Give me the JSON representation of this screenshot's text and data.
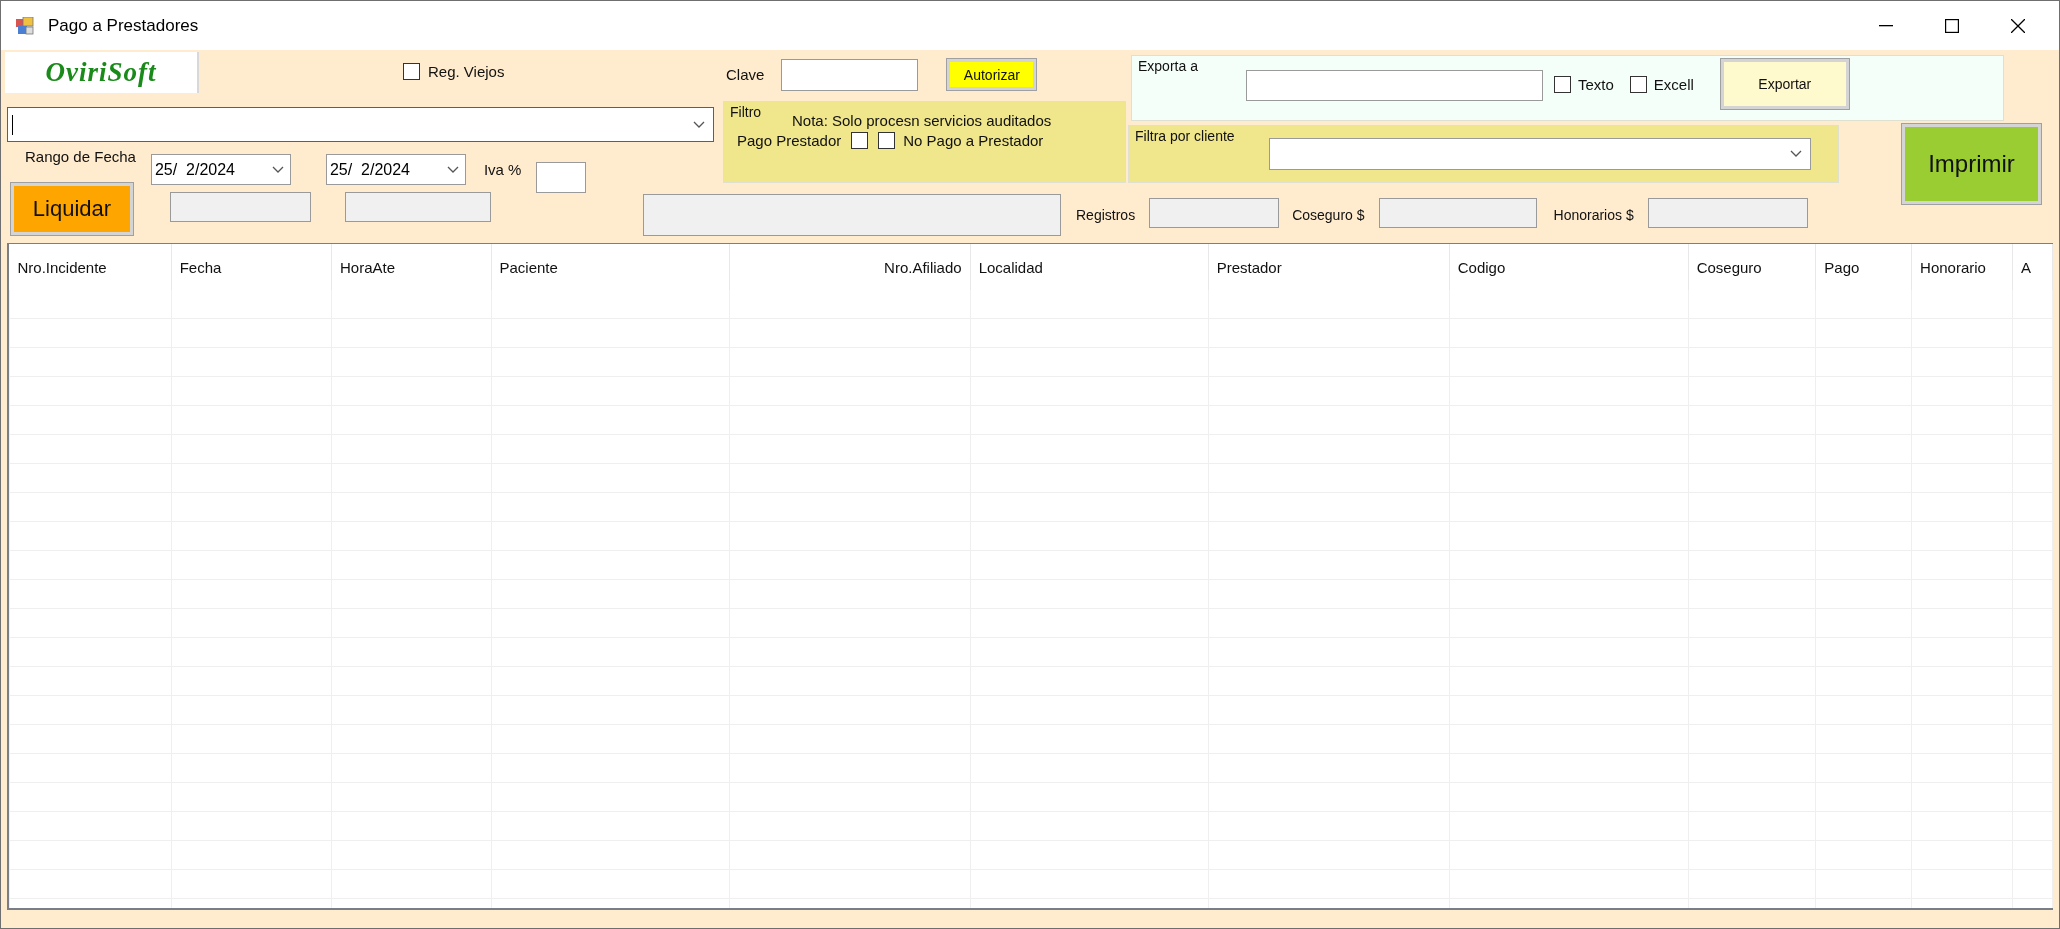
{
  "window": {
    "title": "Pago a Prestadores"
  },
  "logo": {
    "text": "OviriSoft"
  },
  "reg_viejos": {
    "label": "Reg. Viejos",
    "checked": false
  },
  "date_range": {
    "label": "Rango de Fecha",
    "from": "25/  2/2024",
    "to": "25/  2/2024"
  },
  "iva": {
    "label": "Iva %"
  },
  "liquidar_button": "Liquidar",
  "clave": {
    "label": "Clave"
  },
  "autorizar_button": "Autorizar",
  "filtro": {
    "title": "Filtro",
    "note": "Nota: Solo procesn servicios auditados",
    "options": [
      {
        "label": "Pago Prestador",
        "checked": false,
        "kind": "leading"
      },
      {
        "label": "No Pago a Prestador",
        "checked": false,
        "kind": "trailing"
      }
    ]
  },
  "export": {
    "title": "Exporta a",
    "options": [
      {
        "label": "Texto",
        "checked": false
      },
      {
        "label": "Excell",
        "checked": false
      }
    ],
    "button": "Exportar"
  },
  "client_filter": {
    "title": "Filtra por cliente"
  },
  "imprimir_button": "Imprimir",
  "totals": [
    {
      "label": "Registros"
    },
    {
      "label": "Coseguro $"
    },
    {
      "label": "Honorarios $"
    }
  ],
  "table": {
    "columns": [
      {
        "label": "Nro.Incidente"
      },
      {
        "label": "Fecha"
      },
      {
        "label": "HoraAte"
      },
      {
        "label": "Paciente"
      },
      {
        "label": "Nro.Afiliado"
      },
      {
        "label": "Localidad"
      },
      {
        "label": "Prestador"
      },
      {
        "label": "Codigo"
      },
      {
        "label": "Coseguro"
      },
      {
        "label": "Pago"
      },
      {
        "label": "Honorario"
      },
      {
        "label": "A"
      }
    ]
  }
}
